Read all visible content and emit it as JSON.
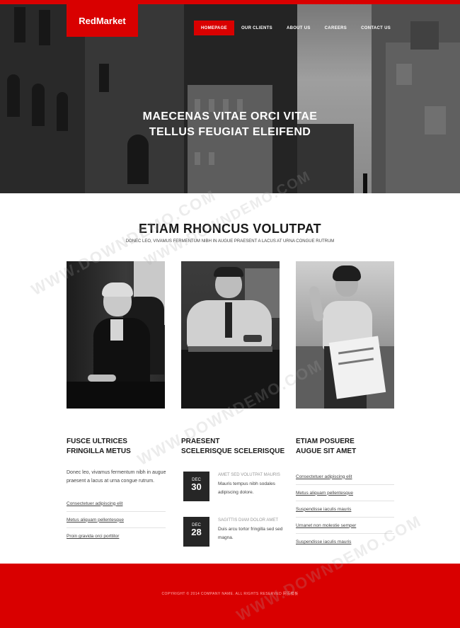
{
  "brand": {
    "logo_text": "RedMarket",
    "accent_color": "#d90000"
  },
  "nav": {
    "items": [
      {
        "label": "HOMEPAGE",
        "active": true
      },
      {
        "label": "OUR CLIENTS",
        "active": false
      },
      {
        "label": "ABOUT US",
        "active": false
      },
      {
        "label": "CAREERS",
        "active": false
      },
      {
        "label": "CONTACT US",
        "active": false
      }
    ]
  },
  "hero": {
    "line1": "MAECENAS VITAE ORCI VITAE",
    "line2": "TELLUS FEUGIAT ELEIFEND"
  },
  "section": {
    "title": "ETIAM RHONCUS VOLUTPAT",
    "subtitle": "DONEC LEO, VIVAMUS FERMENTUM NIBH IN AUGUE PRAESENT A LACUS AT URNA CONGUE RUTRUM"
  },
  "columns": {
    "col1": {
      "heading_line1": "FUSCE ULTRICES",
      "heading_line2": "FRINGILLA METUS",
      "text": "Donec leo, vivamus fermentum nibh in augue praesent a lacus at urna congue rutrum.",
      "links": [
        "Consectetuer adipiscing elit",
        "Metus aliquam pellentesque",
        "Proin gravida orci porttitor"
      ]
    },
    "col2": {
      "heading_line1": "PRAESENT",
      "heading_line2": "SCELERISQUE SCELERISQUE",
      "news": [
        {
          "month": "DEC",
          "day": "30",
          "title": "AMET SED VOLUTPAT MAURIS",
          "text": "Mauris tempus nibh sodales adipiscing dolore."
        },
        {
          "month": "DEC",
          "day": "28",
          "title": "SAGITTIS DIAM DOLOR AMET",
          "text": "Duis arcu tortor fringilla sed sed magna."
        }
      ]
    },
    "col3": {
      "heading_line1": "ETIAM POSUERE",
      "heading_line2": "AUGUE SIT AMET",
      "links": [
        "Consectetuer adipiscing elit",
        "Metus aliquam pellentesque",
        "Suspendisse iaculis mauris",
        "Urnanet non molestie semper",
        "Suspendisse iaculis mauris"
      ]
    }
  },
  "footer": {
    "copyright": "COPYRIGHT © 2014 COMPANY NAME. ALL RIGHTS RESERVED 网页模板"
  },
  "watermark": {
    "text": "WWW.DOWNDEMO.COM"
  }
}
